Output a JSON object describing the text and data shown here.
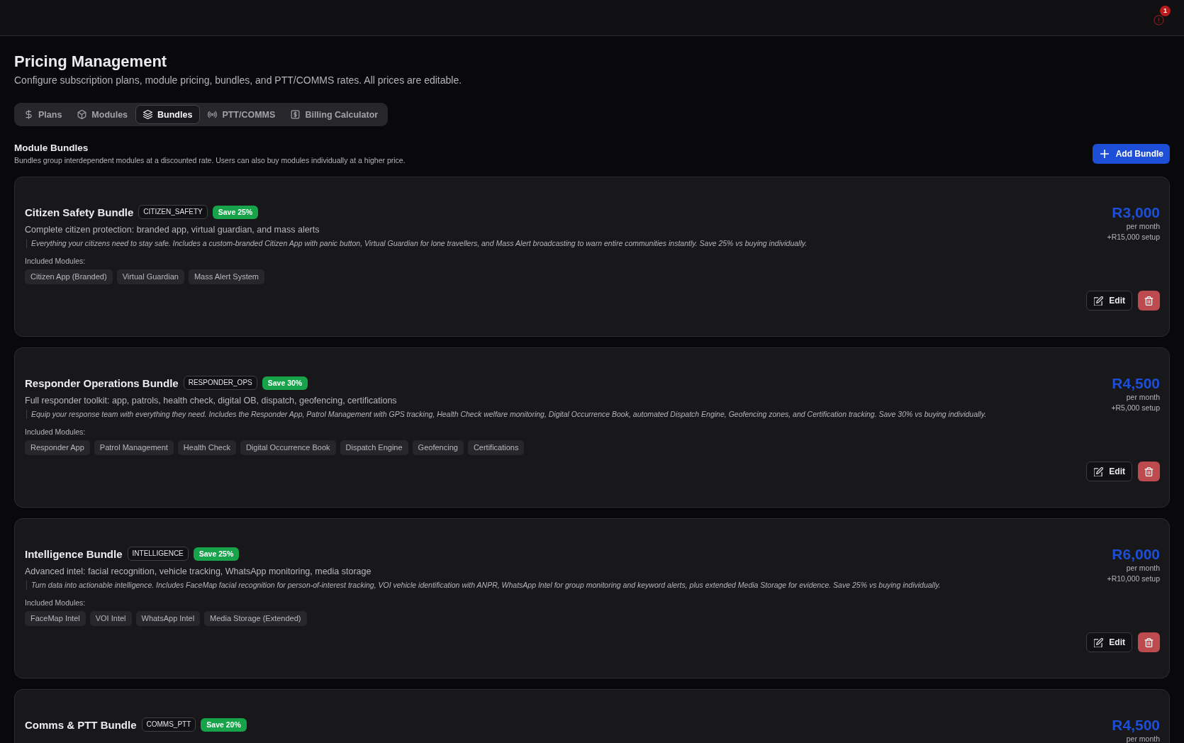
{
  "top_bar": {
    "notification_count": "1"
  },
  "header": {
    "title": "Pricing Management",
    "subtitle": "Configure subscription plans, module pricing, bundles, and PTT/COMMS rates. All prices are editable."
  },
  "tabs": [
    {
      "label": "Plans",
      "selected": false
    },
    {
      "label": "Modules",
      "selected": false
    },
    {
      "label": "Bundles",
      "selected": true
    },
    {
      "label": "PTT/COMMS",
      "selected": false
    },
    {
      "label": "Billing Calculator",
      "selected": false
    }
  ],
  "section": {
    "title": "Module Bundles",
    "subtitle": "Bundles group interdependent modules at a discounted rate. Users can also buy modules individually at a higher price.",
    "add_button": "Add Bundle"
  },
  "bundles": [
    {
      "name": "Citizen Safety Bundle",
      "code": "CITIZEN_SAFETY",
      "savings": "Save 25%",
      "summary": "Complete citizen protection: branded app, virtual guardian, and mass alerts",
      "details": "Everything your citizens need to stay safe. Includes a custom-branded Citizen App with panic button, Virtual Guardian for lone travellers, and Mass Alert broadcasting to warn entire communities instantly. Save 25% vs buying individually.",
      "modules_label": "Included Modules:",
      "modules": [
        "Citizen App (Branded)",
        "Virtual Guardian",
        "Mass Alert System"
      ],
      "price": "R3,000",
      "period": "per month",
      "setup": "+R15,000 setup",
      "edit_label": "Edit"
    },
    {
      "name": "Responder Operations Bundle",
      "code": "RESPONDER_OPS",
      "savings": "Save 30%",
      "summary": "Full responder toolkit: app, patrols, health check, digital OB, dispatch, geofencing, certifications",
      "details": "Equip your response team with everything they need. Includes the Responder App, Patrol Management with GPS tracking, Health Check welfare monitoring, Digital Occurrence Book, automated Dispatch Engine, Geofencing zones, and Certification tracking. Save 30% vs buying individually.",
      "modules_label": "Included Modules:",
      "modules": [
        "Responder App",
        "Patrol Management",
        "Health Check",
        "Digital Occurrence Book",
        "Dispatch Engine",
        "Geofencing",
        "Certifications"
      ],
      "price": "R4,500",
      "period": "per month",
      "setup": "+R5,000 setup",
      "edit_label": "Edit"
    },
    {
      "name": "Intelligence Bundle",
      "code": "INTELLIGENCE",
      "savings": "Save 25%",
      "summary": "Advanced intel: facial recognition, vehicle tracking, WhatsApp monitoring, media storage",
      "details": "Turn data into actionable intelligence. Includes FaceMap facial recognition for person-of-interest tracking, VOI vehicle identification with ANPR, WhatsApp Intel for group monitoring and keyword alerts, plus extended Media Storage for evidence. Save 25% vs buying individually.",
      "modules_label": "Included Modules:",
      "modules": [
        "FaceMap Intel",
        "VOI Intel",
        "WhatsApp Intel",
        "Media Storage (Extended)"
      ],
      "price": "R6,000",
      "period": "per month",
      "setup": "+R10,000 setup",
      "edit_label": "Edit"
    },
    {
      "name": "Comms & PTT Bundle",
      "code": "COMMS_PTT",
      "savings": "Save 20%",
      "price": "R4,500",
      "period": "per month"
    }
  ]
}
